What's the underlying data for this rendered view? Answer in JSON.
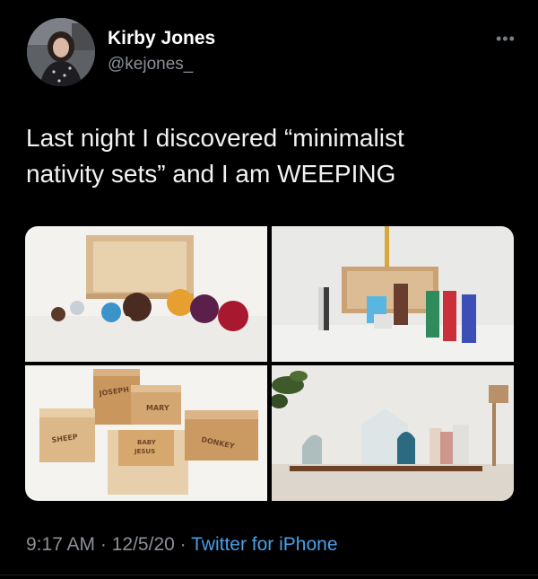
{
  "author": {
    "name": "Kirby Jones",
    "handle": "@kejones_"
  },
  "tweet": {
    "line1": "Last night I discovered “minimalist",
    "line2": "nativity sets” and I am WEEPING"
  },
  "media": {
    "labels": [
      "JOSEPH",
      "MARY",
      "SHEEP",
      "BABY",
      "JESUS",
      "DONKEY"
    ]
  },
  "meta": {
    "time": "9:17 AM",
    "sep1": " · ",
    "date": "12/5/20",
    "sep2": " · ",
    "source": "Twitter for iPhone"
  },
  "icons": {
    "more": "more-horizontal-icon"
  }
}
